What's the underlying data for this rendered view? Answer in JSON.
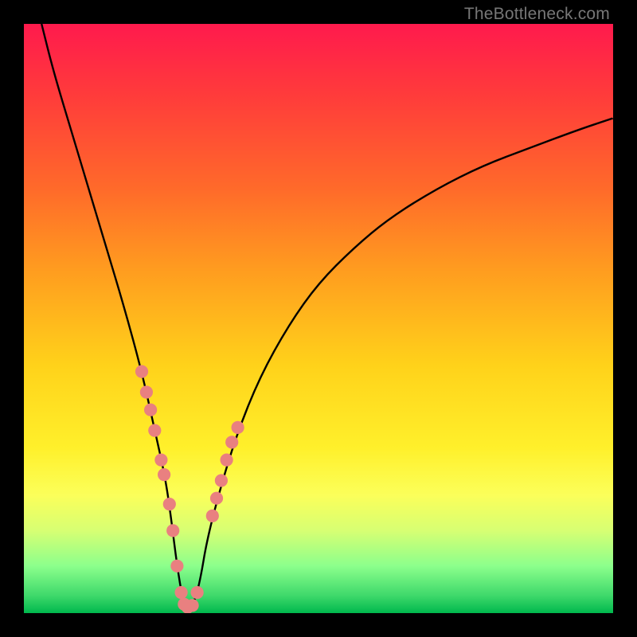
{
  "watermark": "TheBottleneck.com",
  "chart_data": {
    "type": "line",
    "title": "",
    "xlabel": "",
    "ylabel": "",
    "xlim": [
      0,
      100
    ],
    "ylim": [
      0,
      100
    ],
    "gradient_stops": [
      {
        "pos": 0,
        "color": "#ff1a4d"
      },
      {
        "pos": 12,
        "color": "#ff3b3b"
      },
      {
        "pos": 28,
        "color": "#ff6a2a"
      },
      {
        "pos": 42,
        "color": "#ff9d1f"
      },
      {
        "pos": 58,
        "color": "#ffd21a"
      },
      {
        "pos": 72,
        "color": "#fff02b"
      },
      {
        "pos": 80,
        "color": "#fbff5a"
      },
      {
        "pos": 86,
        "color": "#d7ff73"
      },
      {
        "pos": 92,
        "color": "#8cff8c"
      },
      {
        "pos": 97,
        "color": "#3fd96b"
      },
      {
        "pos": 100,
        "color": "#00b84d"
      }
    ],
    "curve": {
      "description": "V-shaped bottleneck curve: y is percent distance from optimal; 0 at the minimum",
      "min_x": 27,
      "series": [
        {
          "name": "bottleneck",
          "x": [
            3,
            5,
            8,
            11,
            14,
            17,
            20,
            22,
            24,
            25,
            26,
            27,
            28,
            29,
            30,
            31,
            33,
            36,
            40,
            45,
            50,
            56,
            62,
            70,
            78,
            86,
            94,
            100
          ],
          "y": [
            100,
            92,
            82,
            72,
            62,
            52,
            41,
            32,
            23,
            16,
            8,
            2,
            1,
            2,
            6,
            12,
            20,
            30,
            40,
            49,
            56,
            62,
            67,
            72,
            76,
            79,
            82,
            84
          ]
        }
      ]
    },
    "markers": {
      "description": "salmon-colored dots plotted along the curve near the valley",
      "color": "#e98080",
      "radius_pct": 1.1,
      "points": [
        {
          "x": 20.0,
          "y": 41.0
        },
        {
          "x": 20.8,
          "y": 37.5
        },
        {
          "x": 21.5,
          "y": 34.5
        },
        {
          "x": 22.2,
          "y": 31.0
        },
        {
          "x": 23.3,
          "y": 26.0
        },
        {
          "x": 23.8,
          "y": 23.5
        },
        {
          "x": 24.7,
          "y": 18.5
        },
        {
          "x": 25.3,
          "y": 14.0
        },
        {
          "x": 26.0,
          "y": 8.0
        },
        {
          "x": 26.7,
          "y": 3.5
        },
        {
          "x": 27.2,
          "y": 1.5
        },
        {
          "x": 27.8,
          "y": 1.0
        },
        {
          "x": 28.6,
          "y": 1.3
        },
        {
          "x": 29.4,
          "y": 3.5
        },
        {
          "x": 32.0,
          "y": 16.5
        },
        {
          "x": 32.7,
          "y": 19.5
        },
        {
          "x": 33.5,
          "y": 22.5
        },
        {
          "x": 34.4,
          "y": 26.0
        },
        {
          "x": 35.3,
          "y": 29.0
        },
        {
          "x": 36.3,
          "y": 31.5
        }
      ]
    }
  }
}
